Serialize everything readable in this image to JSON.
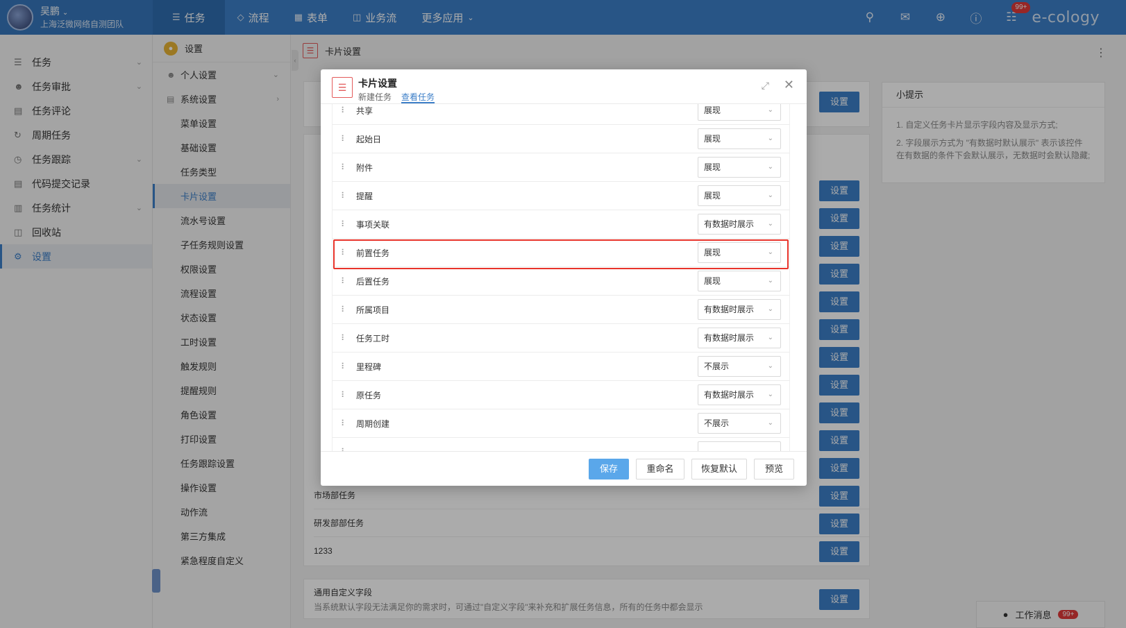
{
  "topbar": {
    "user_name": "吴鹏",
    "user_team": "上海泛微网络自测团队",
    "nav": [
      {
        "label": "任务",
        "icon": "list-icon"
      },
      {
        "label": "流程",
        "icon": "layers-icon"
      },
      {
        "label": "表单",
        "icon": "table-icon"
      },
      {
        "label": "业务流",
        "icon": "flow-icon"
      },
      {
        "label": "更多应用",
        "icon": "chevron-down-icon"
      }
    ],
    "badge": "99+",
    "brand": "e-cology"
  },
  "sidebar": {
    "items": [
      {
        "label": "任务",
        "icon": "list-icon",
        "has_chevron": true
      },
      {
        "label": "任务审批",
        "icon": "user-check-icon",
        "has_chevron": true
      },
      {
        "label": "任务评论",
        "icon": "comment-icon",
        "has_chevron": false
      },
      {
        "label": "周期任务",
        "icon": "cycle-icon",
        "has_chevron": false
      },
      {
        "label": "任务跟踪",
        "icon": "clock-icon",
        "has_chevron": true
      },
      {
        "label": "代码提交记录",
        "icon": "code-icon",
        "has_chevron": false
      },
      {
        "label": "任务统计",
        "icon": "chart-icon",
        "has_chevron": true
      },
      {
        "label": "回收站",
        "icon": "trash-icon",
        "has_chevron": false
      },
      {
        "label": "设置",
        "icon": "gear-icon",
        "has_chevron": false,
        "active": true
      }
    ]
  },
  "subnav": {
    "head": "设置",
    "groups": [
      {
        "label": "个人设置",
        "chevron": "down"
      },
      {
        "label": "系统设置",
        "chevron": "right"
      }
    ],
    "items": [
      "菜单设置",
      "基础设置",
      "任务类型",
      "卡片设置",
      "流水号设置",
      "子任务规则设置",
      "权限设置",
      "流程设置",
      "状态设置",
      "工时设置",
      "触发规则",
      "提醒规则",
      "角色设置",
      "打印设置",
      "任务跟踪设置",
      "操作设置",
      "动作流",
      "第三方集成",
      "紧急程度自定义"
    ],
    "active_index": 3
  },
  "main": {
    "title": "卡片设置",
    "bg_rows": [
      "市场部任务",
      "研发部部任务",
      "1233"
    ],
    "set_label": "设置",
    "custom_field_title": "通用自定义字段",
    "custom_field_desc": "当系统默认字段无法满足你的需求时，可通过\"自定义字段\"来补充和扩展任务信息，所有的任务中都会显示"
  },
  "tips": {
    "title": "小提示",
    "lines": [
      "1. 自定义任务卡片显示字段内容及显示方式;",
      "2. 字段展示方式为 \"有数据时默认展示\" 表示该控件在有数据的条件下会默认展示，无数据时会默认隐藏;"
    ]
  },
  "footer": {
    "label": "工作消息",
    "badge": "99+"
  },
  "modal": {
    "title": "卡片设置",
    "tabs": [
      "新建任务",
      "查看任务"
    ],
    "active_tab": 1,
    "fields": [
      {
        "name": "共享",
        "value": "展现"
      },
      {
        "name": "起始日",
        "value": "展现"
      },
      {
        "name": "附件",
        "value": "展现"
      },
      {
        "name": "提醒",
        "value": "展现"
      },
      {
        "name": "事项关联",
        "value": "有数据时展示"
      },
      {
        "name": "前置任务",
        "value": "展现"
      },
      {
        "name": "后置任务",
        "value": "展现"
      },
      {
        "name": "所属项目",
        "value": "有数据时展示"
      },
      {
        "name": "任务工时",
        "value": "有数据时展示"
      },
      {
        "name": "里程碑",
        "value": "不展示"
      },
      {
        "name": "原任务",
        "value": "有数据时展示"
      },
      {
        "name": "周期创建",
        "value": "不展示"
      }
    ],
    "buttons": {
      "save": "保存",
      "rename": "重命名",
      "reset": "恢复默认",
      "preview": "预览"
    }
  }
}
